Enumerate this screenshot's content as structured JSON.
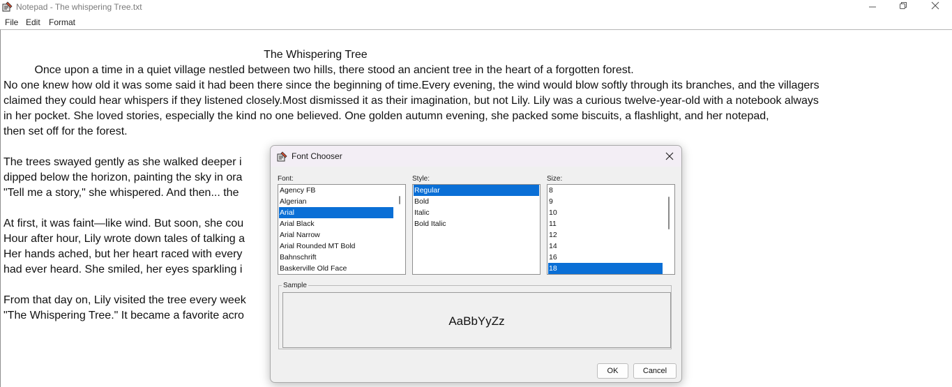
{
  "window": {
    "title": "Notepad - The whispering Tree.txt",
    "icon": "notepad-app-icon",
    "controls": {
      "minimize": "minimize-icon",
      "maximize": "restore-icon",
      "close": "close-icon"
    }
  },
  "menu": {
    "file": "File",
    "edit": "Edit",
    "format": "Format"
  },
  "document": {
    "lines": [
      "                                                                                    The Whispering Tree",
      "          Once upon a time in a quiet village nestled between two hills, there stood an ancient tree in the heart of a forgotten forest.",
      "No one knew how old it was some said it had been there since the beginning of time.Every evening, the wind would blow softly through its branches, and the villagers",
      "claimed they could hear whispers if they listened closely.Most dismissed it as their imagination, but not Lily. Lily was a curious twelve-year-old with a notebook always",
      "in her pocket. She loved stories, especially the kind no one believed. One golden autumn evening, she packed some biscuits, a flashlight, and her notepad,",
      "then set off for the forest.",
      "",
      "The trees swayed gently as she walked deeper i                                                                                                       the sun had just",
      "dipped below the horizon, painting the sky in ora                                                                                                     book.",
      "\"Tell me a story,\" she whispered. And then... the",
      "",
      "At first, it was faint—like wind. But soon, she cou",
      "Hour after hour, Lily wrote down tales of talking a                                                                                                    the winds.",
      "Her hands ached, but her heart raced with every                                                                                                     stories no one",
      "had ever heard. She smiled, her eyes sparkling i",
      "",
      "From that day on, Lily visited the tree every week                                                                                                   ed",
      "\"The Whispering Tree.\" It became a favorite acro"
    ]
  },
  "font_chooser": {
    "title": "Font Chooser",
    "icon": "java-app-icon",
    "font_label": "Font:",
    "style_label": "Style:",
    "size_label": "Size:",
    "fonts": [
      "Agency FB",
      "Algerian",
      "Arial",
      "Arial Black",
      "Arial Narrow",
      "Arial Rounded MT Bold",
      "Bahnschrift",
      "Baskerville Old Face"
    ],
    "selected_font": "Arial",
    "styles": [
      "Regular",
      "Bold",
      "Italic",
      "Bold Italic"
    ],
    "selected_style": "Regular",
    "sizes": [
      "8",
      "9",
      "10",
      "11",
      "12",
      "14",
      "16",
      "18"
    ],
    "selected_size": "18",
    "sample_label": "Sample",
    "sample_text": "AaBbYyZz",
    "ok_label": "OK",
    "cancel_label": "Cancel",
    "accent_color": "#0a6fd6"
  }
}
